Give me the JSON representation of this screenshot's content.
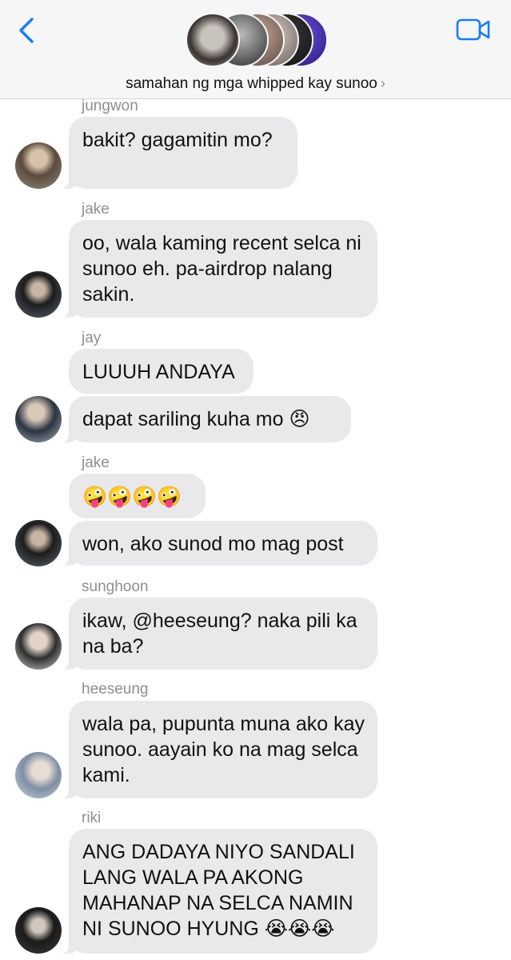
{
  "header": {
    "group_name": "samahan ng mga whipped kay sunoo",
    "chevron": "›",
    "back_icon": "chevron-left-icon",
    "video_icon": "video-camera-icon",
    "accent": "#1a7cf5"
  },
  "messages": [
    {
      "sender": "jungwon",
      "text": "bakit? gagamitin mo?"
    },
    {
      "sender": "jake",
      "text": "oo, wala kaming recent selca ni sunoo eh. pa-airdrop nalang sakin."
    },
    {
      "sender": "jay",
      "text": "LUUUH ANDAYA"
    },
    {
      "sender": "",
      "text": "dapat sariling kuha mo 😠"
    },
    {
      "sender": "jake",
      "text": "🤪🤪🤪🤪"
    },
    {
      "sender": "",
      "text": "won, ako sunod mo mag post"
    },
    {
      "sender": "sunghoon",
      "text": "ikaw, @heeseung? naka pili ka na ba?"
    },
    {
      "sender": "heeseung",
      "text": "wala pa, pupunta muna ako kay sunoo. aayain ko na mag selca kami."
    },
    {
      "sender": "riki",
      "text": "ANG DADAYA NIYO SANDALI LANG WALA PA AKONG MAHANAP NA SELCA NAMIN NI SUNOO HYUNG 😭😭😭"
    }
  ],
  "colors": {
    "bubble": "#e9e9eb",
    "sender_label": "#8e8e93",
    "header_bg": "#f6f6f7"
  }
}
